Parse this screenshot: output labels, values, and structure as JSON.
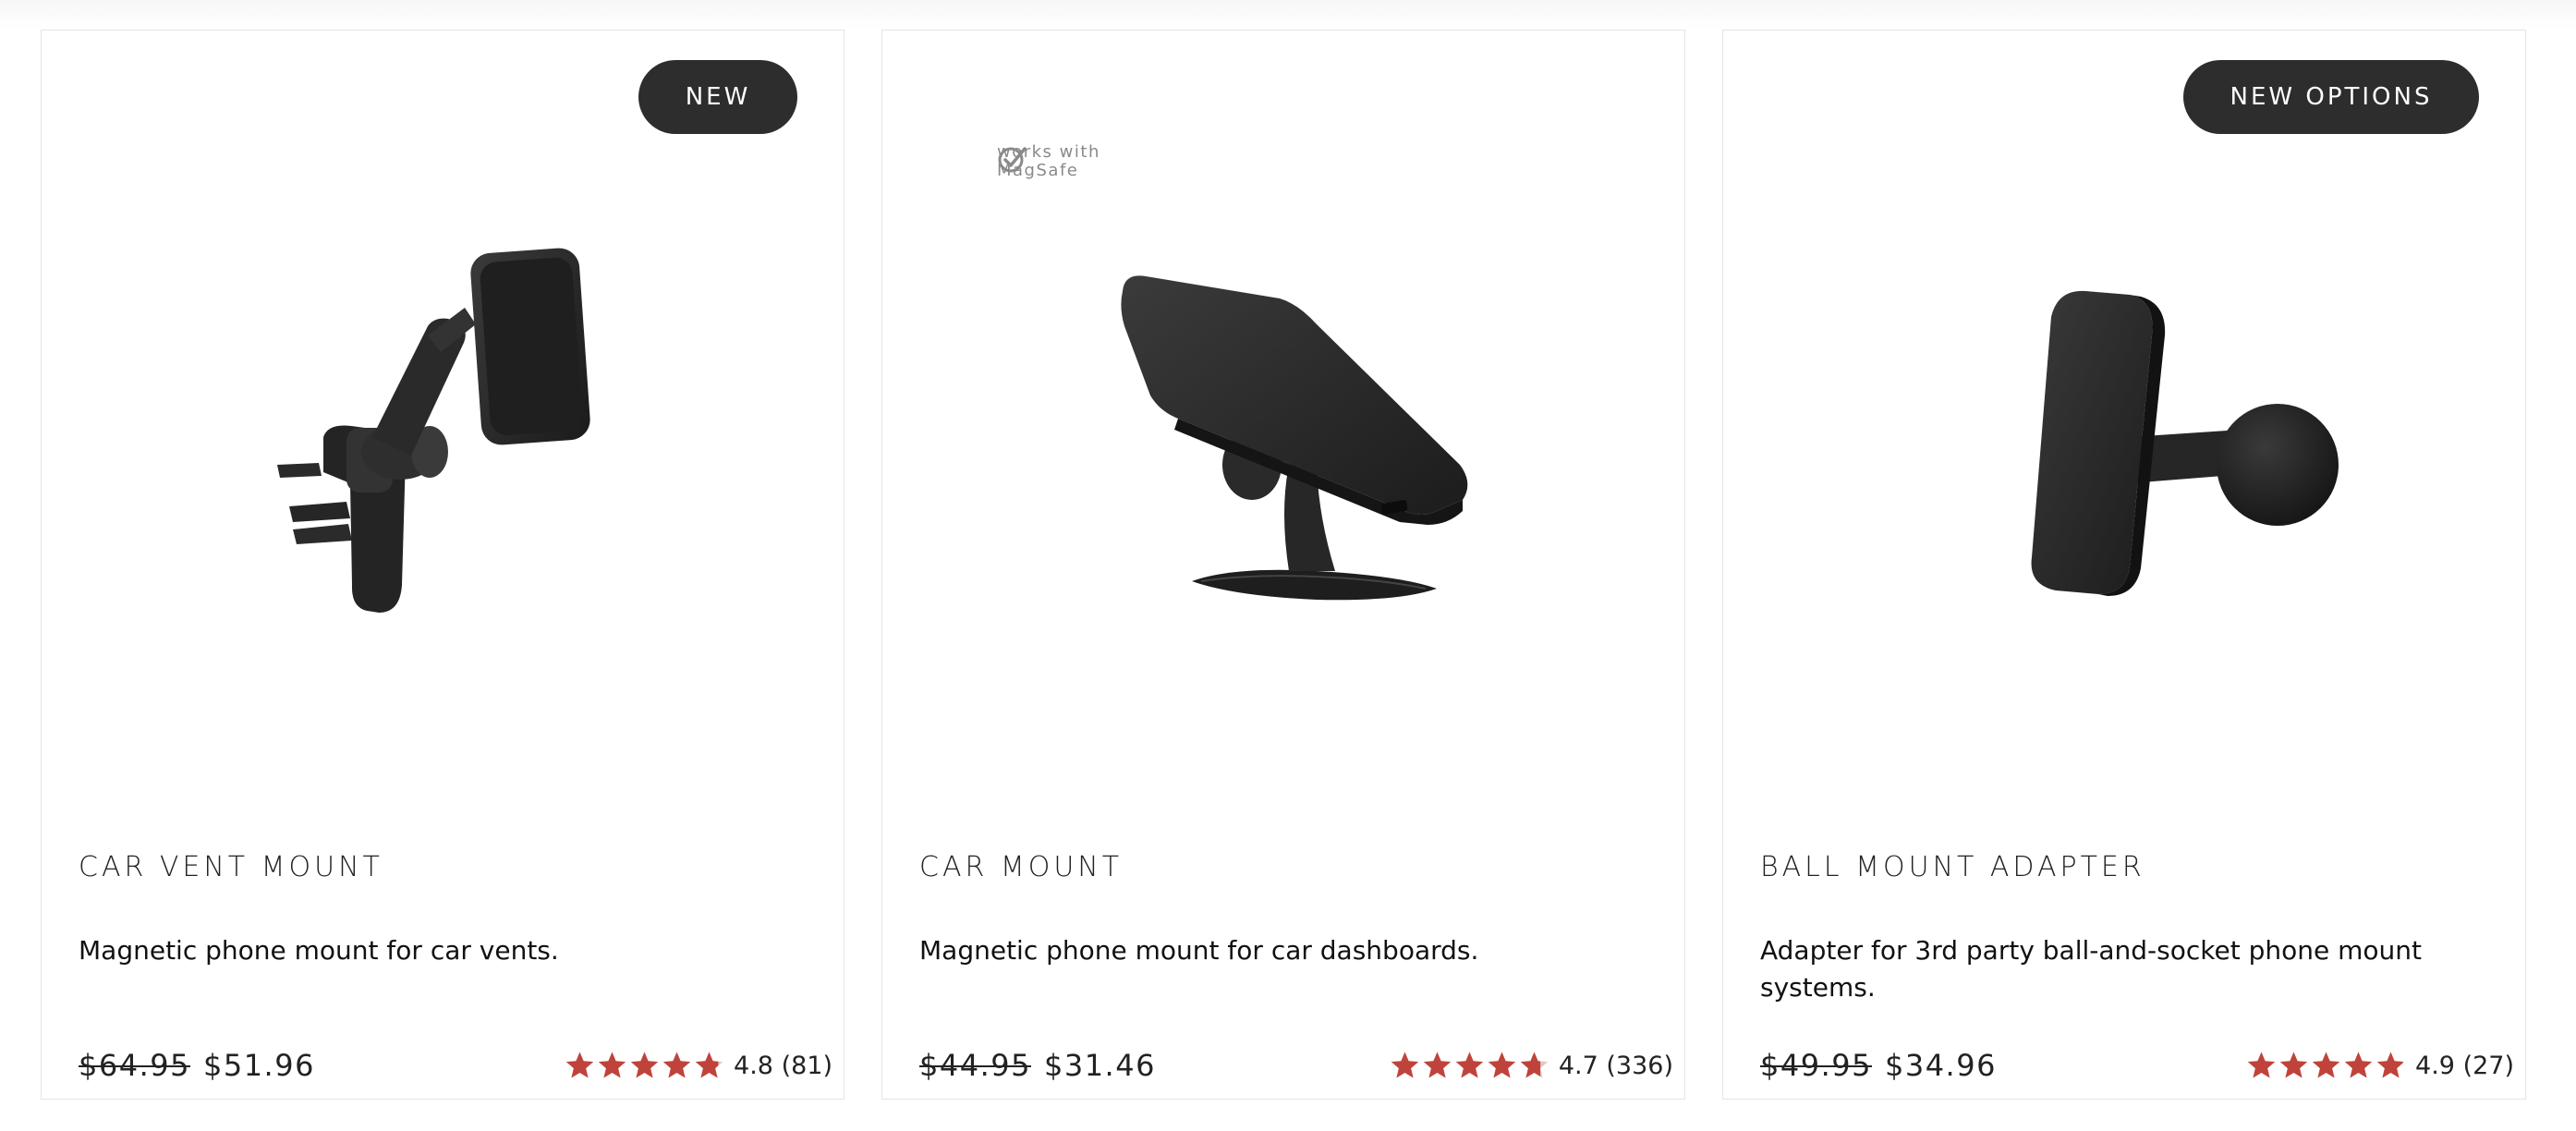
{
  "products": [
    {
      "badge": "NEW",
      "title": "CAR VENT MOUNT",
      "description": "Magnetic phone mount for car vents.",
      "price_old": "$64.95",
      "price_new": "$51.96",
      "rating_text": "4.8 (81)",
      "rating": 4.8,
      "image_icon": "car-vent-mount-product-image"
    },
    {
      "badge": "",
      "magsafe_label": "works with\nMagSafe",
      "title": "CAR MOUNT",
      "description": "Magnetic phone mount for car dashboards.",
      "price_old": "$44.95",
      "price_new": "$31.46",
      "rating_text": "4.7 (336)",
      "rating": 4.7,
      "image_icon": "car-dash-mount-product-image"
    },
    {
      "badge": "NEW OPTIONS",
      "title": "BALL MOUNT ADAPTER",
      "description": "Adapter for 3rd party ball-and-socket phone mount systems.",
      "price_old": "$49.95",
      "price_new": "$34.96",
      "rating_text": "4.9 (27)",
      "rating": 4.9,
      "image_icon": "ball-mount-adapter-product-image"
    }
  ],
  "colors": {
    "badge_bg": "#2e2d2d",
    "star": "#c0433b",
    "border": "#e4e4e4"
  }
}
